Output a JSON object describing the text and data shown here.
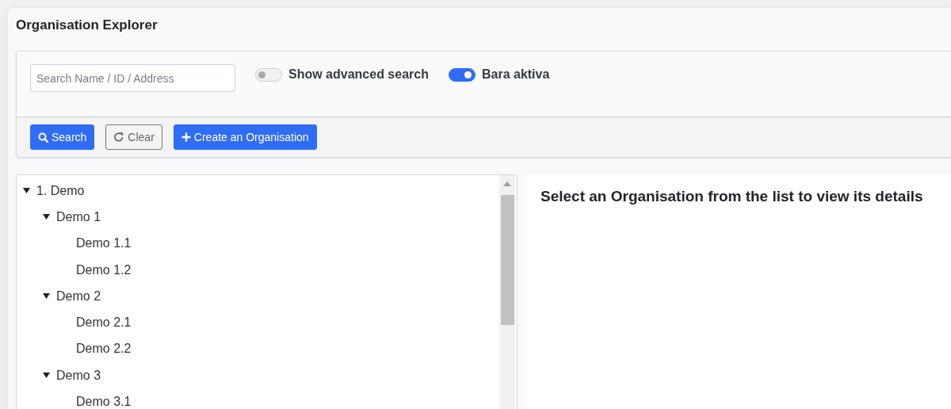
{
  "page": {
    "title": "Organisation Explorer"
  },
  "search": {
    "placeholder": "Search Name / ID / Address"
  },
  "toggles": [
    {
      "label": "Show advanced search",
      "on": false
    },
    {
      "label": "Bara aktiva",
      "on": true
    }
  ],
  "buttons": [
    {
      "label": "Search",
      "kind": "search"
    },
    {
      "label": "Clear",
      "kind": "clear"
    },
    {
      "label": "Create an Organisation",
      "kind": "create"
    }
  ],
  "tree": [
    {
      "label": "1. Demo",
      "expanded": true,
      "children": [
        {
          "label": "Demo 1",
          "expanded": true,
          "children": [
            {
              "label": "Demo 1.1"
            },
            {
              "label": "Demo 1.2"
            }
          ]
        },
        {
          "label": "Demo 2",
          "expanded": true,
          "children": [
            {
              "label": "Demo 2.1"
            },
            {
              "label": "Demo 2.2"
            }
          ]
        },
        {
          "label": "Demo 3",
          "expanded": true,
          "children": [
            {
              "label": "Demo 3.1"
            }
          ]
        }
      ]
    }
  ],
  "details": {
    "message": "Select an Organisation from the list to view its details"
  }
}
